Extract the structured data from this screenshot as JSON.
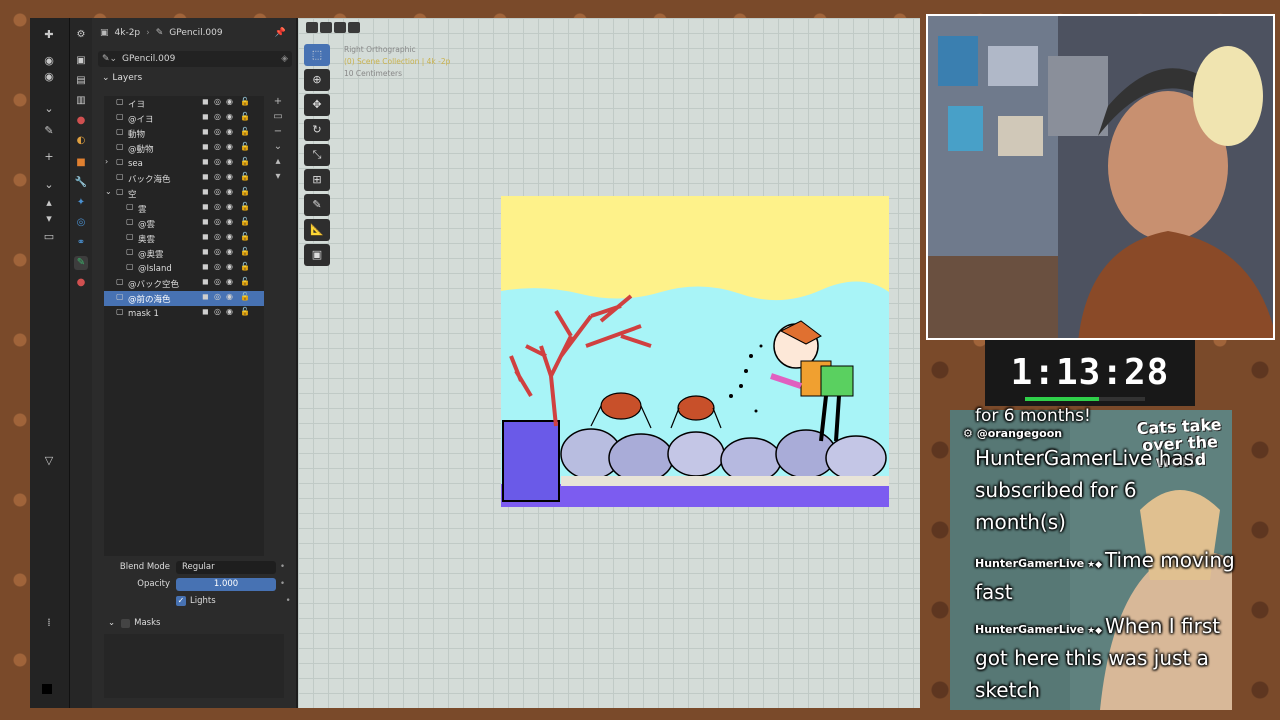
{
  "blender": {
    "breadcrumb": {
      "object": "4k-2p",
      "data": "GPencil.009"
    },
    "data_block": "GPencil.009",
    "panels": {
      "layers_title": "Layers",
      "masks_title": "Masks"
    },
    "layers": [
      {
        "name": "イヨ",
        "indent": 0,
        "expand": "",
        "selected": false
      },
      {
        "name": "@イヨ",
        "indent": 0,
        "expand": "",
        "selected": false
      },
      {
        "name": "動物",
        "indent": 0,
        "expand": "",
        "selected": false
      },
      {
        "name": "@動物",
        "indent": 0,
        "expand": "",
        "selected": false
      },
      {
        "name": "sea",
        "indent": 0,
        "expand": "›",
        "selected": false
      },
      {
        "name": "バック海色",
        "indent": 0,
        "expand": "",
        "selected": false
      },
      {
        "name": "空",
        "indent": 0,
        "expand": "⌄",
        "selected": false
      },
      {
        "name": "雲",
        "indent": 1,
        "expand": "",
        "selected": false
      },
      {
        "name": "@雲",
        "indent": 1,
        "expand": "",
        "selected": false
      },
      {
        "name": "奥雲",
        "indent": 1,
        "expand": "",
        "selected": false
      },
      {
        "name": "@奥雲",
        "indent": 1,
        "expand": "",
        "selected": false
      },
      {
        "name": "@Island",
        "indent": 1,
        "expand": "",
        "selected": false
      },
      {
        "name": "@バック空色",
        "indent": 0,
        "expand": "",
        "selected": false
      },
      {
        "name": "@前の海色",
        "indent": 0,
        "expand": "",
        "selected": true
      },
      {
        "name": "mask 1",
        "indent": 0,
        "expand": "",
        "selected": false
      }
    ],
    "blend_mode": {
      "label": "Blend Mode",
      "value": "Regular"
    },
    "opacity": {
      "label": "Opacity",
      "value": "1.000",
      "fraction": 1.0
    },
    "lights": {
      "label": "Lights",
      "checked": true
    },
    "viewport": {
      "view_name": "Right Orthographic",
      "collection": "(0) Scene Collection | 4k -2p",
      "scale": "10 Centimeters"
    }
  },
  "stream": {
    "timer": "1:13:28",
    "timer_progress": 0.62,
    "banner": "Cats take over the world",
    "colors": {
      "accent_green": "#2fd04a",
      "selection_blue": "#4772b3"
    }
  },
  "chat": [
    {
      "user": "",
      "text": "for 6 months!"
    },
    {
      "user": "@orangegoon",
      "text": ""
    },
    {
      "user": "",
      "text": "HunterGamerLive has subscribed for 6 month(s)"
    },
    {
      "user": "HunterGamerLive",
      "text": "Time moving fast"
    },
    {
      "user": "HunterGamerLive",
      "text": "When I first got here this was just a sketch"
    }
  ]
}
